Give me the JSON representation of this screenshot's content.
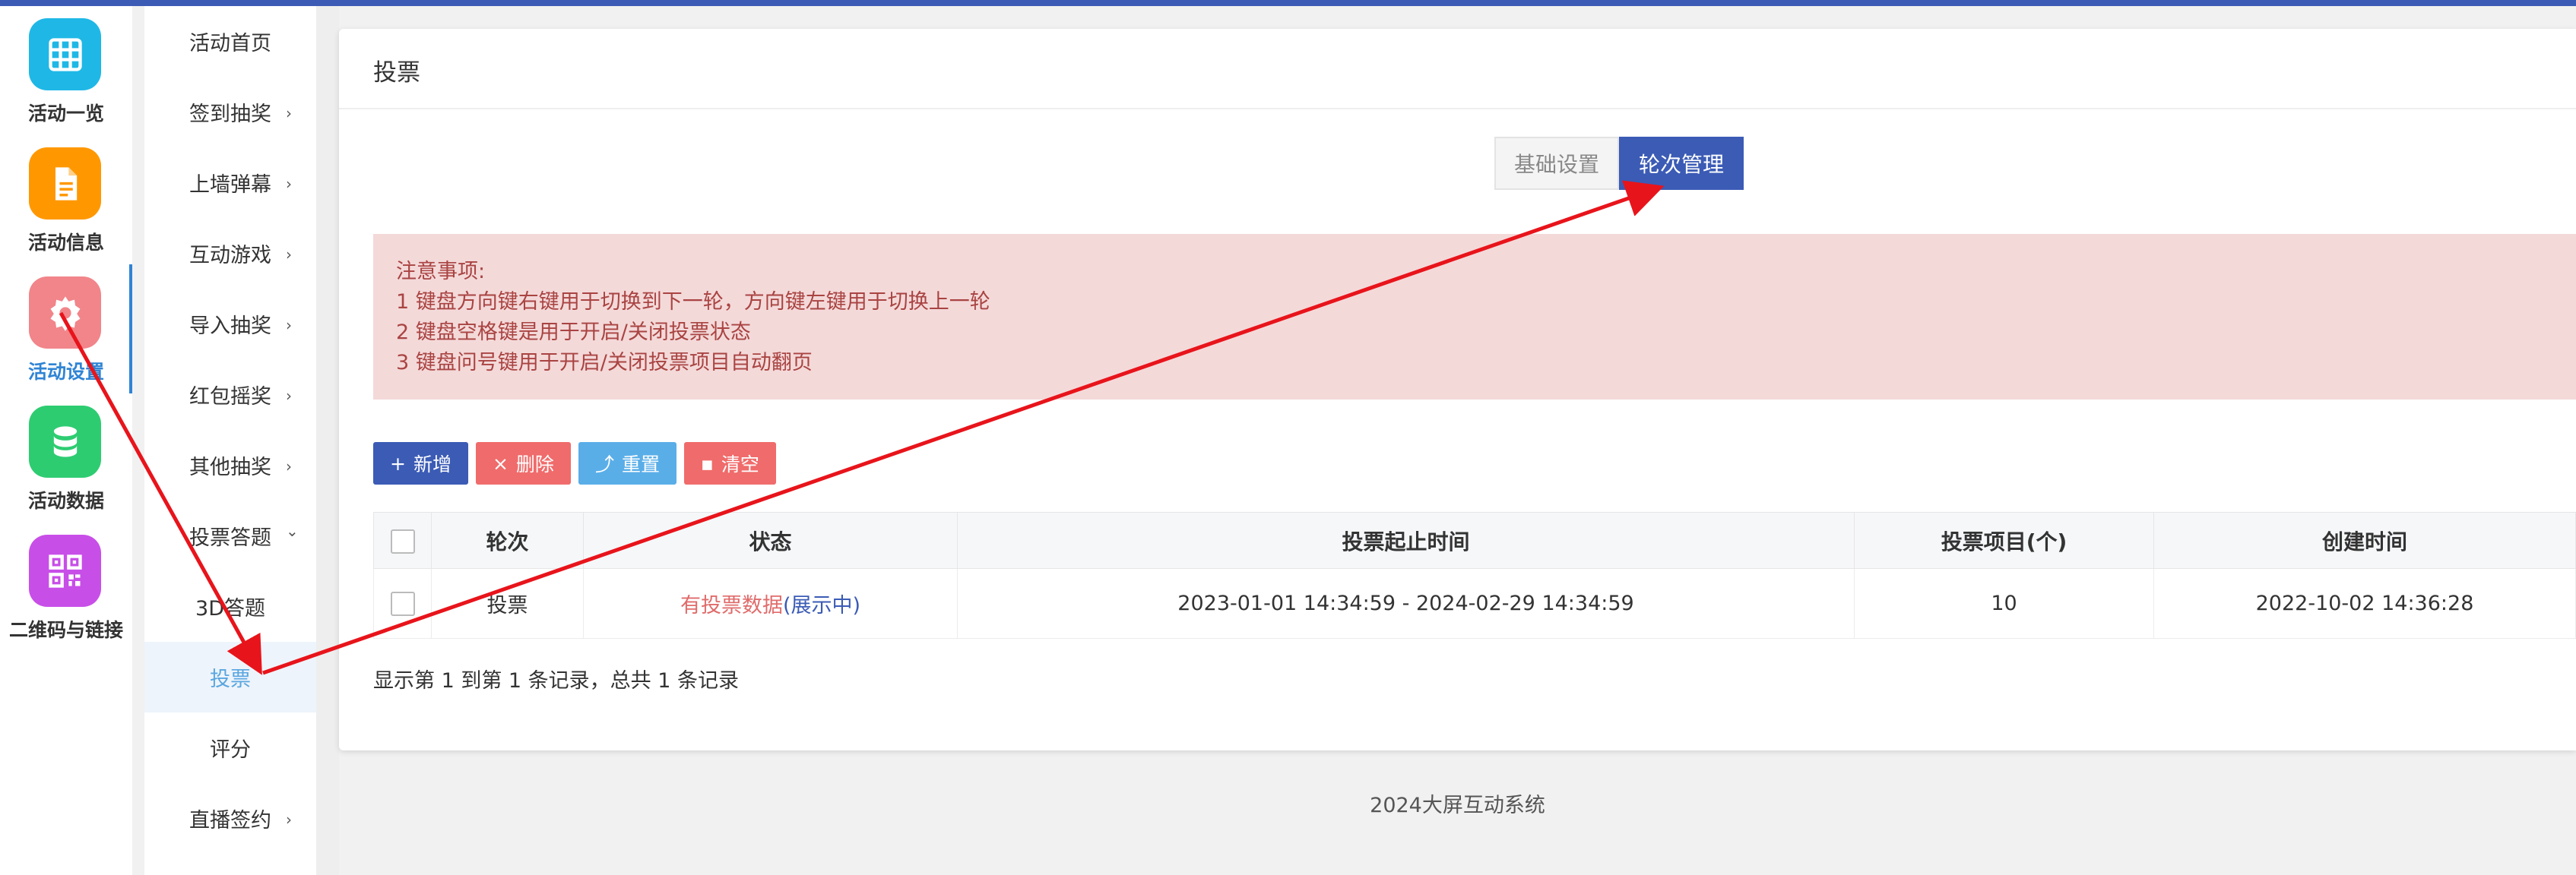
{
  "rail": {
    "items": [
      {
        "label": "活动一览",
        "icon": "grid-icon",
        "color": "#1fb8e6"
      },
      {
        "label": "活动信息",
        "icon": "document-icon",
        "color": "#ff9800"
      },
      {
        "label": "活动设置",
        "icon": "gear-icon",
        "color": "#f1858a"
      },
      {
        "label": "活动数据",
        "icon": "database-icon",
        "color": "#2ecc71"
      },
      {
        "label": "二维码与链接",
        "icon": "qrcode-icon",
        "color": "#c84ee8"
      }
    ],
    "active_index": 2
  },
  "submenu": {
    "items": [
      {
        "label": "活动首页",
        "chevron": ""
      },
      {
        "label": "签到抽奖",
        "chevron": "›"
      },
      {
        "label": "上墙弹幕",
        "chevron": "›"
      },
      {
        "label": "互动游戏",
        "chevron": "›"
      },
      {
        "label": "导入抽奖",
        "chevron": "›"
      },
      {
        "label": "红包摇奖",
        "chevron": "›"
      },
      {
        "label": "其他抽奖",
        "chevron": "›"
      },
      {
        "label": "投票答题",
        "chevron": "⌄"
      },
      {
        "label": "3D答题",
        "chevron": ""
      },
      {
        "label": "投票",
        "chevron": ""
      },
      {
        "label": "评分",
        "chevron": ""
      },
      {
        "label": "直播签约",
        "chevron": "›"
      }
    ],
    "active_index": 9
  },
  "page": {
    "title": "投票",
    "tabs": [
      "基础设置",
      "轮次管理"
    ],
    "active_tab": 1
  },
  "notice": {
    "heading": "注意事项:",
    "lines": [
      "1 键盘方向键右键用于切换到下一轮，方向键左键用于切换上一轮",
      "2 键盘空格键是用于开启/关闭投票状态",
      "3 键盘问号键用于开启/关闭投票项目自动翻页"
    ]
  },
  "toolbar": {
    "add": {
      "icon": "+",
      "label": "新增"
    },
    "delete": {
      "icon": "×",
      "label": "删除"
    },
    "reset": {
      "icon": "⤴",
      "label": "重置"
    },
    "clear": {
      "icon": "▪",
      "label": "清空"
    }
  },
  "table": {
    "headers": [
      "轮次",
      "状态",
      "投票起止时间",
      "投票项目(个)",
      "创建时间"
    ],
    "rows": [
      {
        "round": "投票",
        "status_main": "有投票数据",
        "status_sub": "(展示中)",
        "time_range": "2023-01-01 14:34:59 - 2024-02-29 14:34:59",
        "item_count": "10",
        "created": "2022-10-02 14:36:28"
      }
    ]
  },
  "pager": {
    "info": "显示第 1 到第 1 条记录，总共 1 条记录"
  },
  "footer": {
    "text": "2024大屏互动系统"
  },
  "colors": {
    "brand": "#3b5bb5",
    "annotation": "#e8141b",
    "notice_bg": "#f4d9d9",
    "notice_text": "#a94442"
  }
}
